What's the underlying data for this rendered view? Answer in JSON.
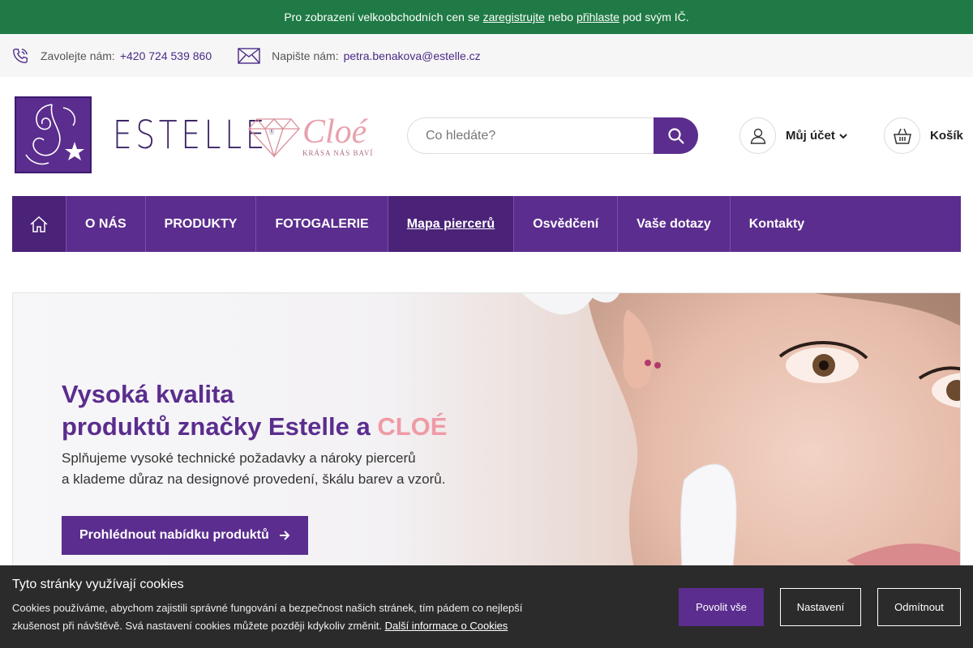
{
  "topbar": {
    "text_before": "Pro zobrazení velkoobchodních cen se",
    "register_link": "zaregistrujte",
    "text_middle": "nebo",
    "login_link": "přihlaste",
    "text_after": "pod svým IČ."
  },
  "contact": {
    "phone_label": "Zavolejte nám:",
    "phone_value": "+420 724 539 860",
    "email_label": "Napište nám:",
    "email_value": "petra.benakova@estelle.cz"
  },
  "logos": {
    "estelle_word": "ESTELLE",
    "estelle_mark": "®",
    "cloe_title": "Cloé",
    "cloe_tagline": "KRÁSA NÁS BAVÍ"
  },
  "search": {
    "placeholder": "Co hledáte?"
  },
  "account": {
    "label": "Můj účet"
  },
  "cart": {
    "label": "Košík"
  },
  "nav": {
    "items": [
      {
        "label": "O NÁS"
      },
      {
        "label": "PRODUKTY"
      },
      {
        "label": "FOTOGALERIE"
      },
      {
        "label": "Mapa piercerů"
      },
      {
        "label": "Osvědčení"
      },
      {
        "label": "Vaše dotazy"
      },
      {
        "label": "Kontakty"
      }
    ],
    "active_index": 3
  },
  "hero": {
    "title_line1": "Vysoká kvalita",
    "title_line2": "produktů značky Estelle a",
    "title_brand": "CLOÉ",
    "desc_line1": "Splňujeme vysoké technické požadavky a nároky piercerů",
    "desc_line2": "a klademe důraz na designové provedení, škálu barev a vzorů.",
    "button_label": "Prohlédnout nabídku produktů"
  },
  "cookies": {
    "title": "Tyto stránky využívají cookies",
    "text": "Cookies používáme, abychom zajistili správné fungování a bezpečnost našich stránek, tím pádem co nejlepší zkušenost při návštěvě. Svá nastavení cookies můžete později kdykoliv změnit.",
    "more_link": "Další informace o Cookies",
    "accept_all": "Povolit vše",
    "settings": "Nastavení",
    "reject": "Odmítnout"
  },
  "colors": {
    "brand_purple": "#5b2d8e",
    "topbar_green": "#1f7a45",
    "cloe_pink": "#ef9aa6"
  }
}
